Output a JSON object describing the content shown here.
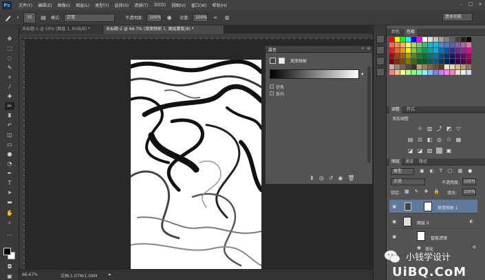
{
  "app": {
    "logo": "Ps"
  },
  "menu": [
    "文件(F)",
    "编辑(E)",
    "图像(I)",
    "图层(L)",
    "类型(Y)",
    "选择(S)",
    "滤镜(T)",
    "3D(D)",
    "视图(V)",
    "窗口(W)",
    "帮助(H)"
  ],
  "window_controls": [
    "–",
    "□",
    "×"
  ],
  "options_bar": {
    "brush_size": "35",
    "mode_label": "模式:",
    "mode_value": "正常",
    "opacity_label": "不透明度:",
    "opacity_value": "100%",
    "flow_label": "流量:",
    "flow_value": "100%",
    "workspace": "基本功能"
  },
  "doc_tabs": [
    {
      "label": "未标题-1 @ 50% (图层 1, RGB/8) *"
    },
    {
      "label": "未标题-2 @ 66.7% (渐变映射 1, 图层蒙版/8) *"
    }
  ],
  "properties": {
    "title": "属性",
    "subtitle": "渐变映射",
    "option_dither": "仿色",
    "option_reverse": "反向"
  },
  "swatch_panel": {
    "tabs": [
      "颜色",
      "色板"
    ]
  },
  "adjust_panel": {
    "tabs": [
      "调整",
      "样式"
    ],
    "title": "添加调整"
  },
  "layers_panel": {
    "tabs": [
      "图层",
      "通道",
      "路径"
    ],
    "kind": "类型",
    "blend_mode": "正常",
    "opacity_label": "不透明度:",
    "opacity_value": "100%",
    "lock_label": "锁定:",
    "fill_label": "填充:",
    "fill_value": "100%",
    "layers": [
      {
        "name": "渐变映射 1",
        "selected": true
      },
      {
        "name": "图层 0"
      },
      {
        "name": "智能滤镜"
      },
      {
        "name": "液化"
      }
    ]
  },
  "status": {
    "zoom": "66.67%",
    "doc": "文档:1.07M/1.09M"
  },
  "watermark": {
    "text": "小钱学设计",
    "brand": "UiBQ.CoM"
  },
  "colors": {
    "menubar": "#424242",
    "panel": "#535353",
    "canvas_bg": "#282828",
    "selected_layer": "#5f7a9c"
  }
}
